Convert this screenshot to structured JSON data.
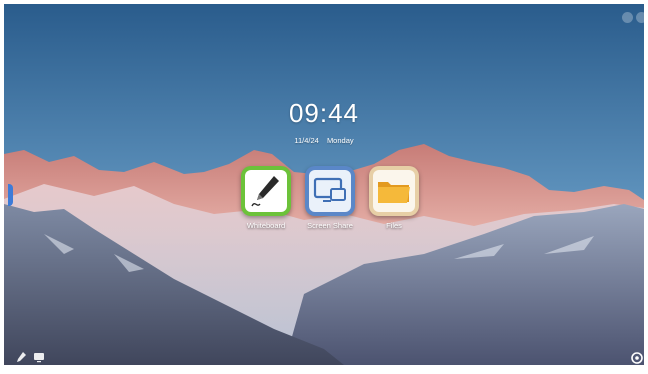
{
  "clock": {
    "time": "09:44",
    "date": "11/4/24",
    "weekday": "Monday"
  },
  "apps": [
    {
      "label": "Whiteboard",
      "icon": "whiteboard-pen-icon",
      "accent": "#6cc23a"
    },
    {
      "label": "Screen Share",
      "icon": "screen-share-icon",
      "accent": "#5a87c8"
    },
    {
      "label": "Files",
      "icon": "folder-icon",
      "accent": "#f2b43c"
    }
  ],
  "status_icons": [
    "wireless-projection-icon",
    "bluetooth-icon"
  ],
  "dock_left": [
    "annotation-pen-icon",
    "screen-window-icon"
  ],
  "dock_right": [
    "settings-gear-icon"
  ],
  "pages": {
    "count": 2,
    "active": 1
  },
  "colors": {
    "sky_top": "#2c5f8f",
    "sky_bottom": "#7fb0cf",
    "mountain_glow": "#e59a8c",
    "snow": "#c9d3e0",
    "handle": "#3d7bd8"
  }
}
